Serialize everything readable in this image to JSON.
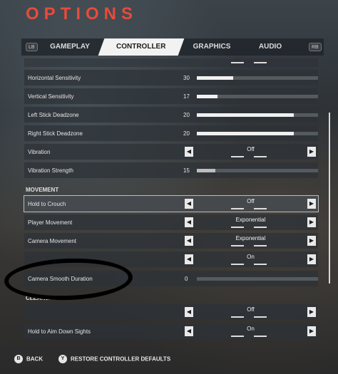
{
  "title": "OPTIONS",
  "tabs": {
    "lb": "LB",
    "rb": "RB",
    "items": [
      {
        "label": "GAMEPLAY"
      },
      {
        "label": "CONTROLLER"
      },
      {
        "label": "GRAPHICS"
      },
      {
        "label": "AUDIO"
      }
    ],
    "active": "CONTROLLER"
  },
  "settings": {
    "horizontal_sensitivity": {
      "label": "Horizontal Sensitivity",
      "value": "30",
      "fill": 0.3
    },
    "vertical_sensitivity": {
      "label": "Vertical Sensitivity",
      "value": "17",
      "fill": 0.17
    },
    "left_stick_deadzone": {
      "label": "Left Stick Deadzone",
      "value": "20",
      "fill": 0.8
    },
    "right_stick_deadzone": {
      "label": "Right Stick Deadzone",
      "value": "20",
      "fill": 0.8
    },
    "vibration": {
      "label": "Vibration",
      "value": "Off"
    },
    "vibration_strength": {
      "label": "Vibration Strength",
      "value": "15",
      "fill": 0.15
    },
    "movement_header": "MOVEMENT",
    "hold_to_crouch": {
      "label": "Hold to Crouch",
      "value": "Off"
    },
    "player_movement": {
      "label": "Player Movement",
      "value": "Exponential"
    },
    "camera_movement": {
      "label": "Camera Movement",
      "value": "Exponential"
    },
    "hidden_toggle": {
      "label": "",
      "value": "On"
    },
    "camera_smooth_duration": {
      "label": "Camera Smooth Duration",
      "value": "0",
      "fill": 0
    },
    "cleaners_header": "CLEANERS",
    "cleaners_toggle": {
      "label": "",
      "value": "Off"
    },
    "hold_to_aim": {
      "label": "Hold to Aim Down Sights",
      "value": "On"
    }
  },
  "footer": {
    "back_button": "B",
    "back_label": "BACK",
    "restore_button": "Y",
    "restore_label": "RESTORE CONTROLLER DEFAULTS"
  },
  "colors": {
    "accent": "#e84a3c",
    "highlight": "#f2f2f2"
  },
  "icons": {
    "left_arrow": "◀",
    "right_arrow": "▶"
  }
}
